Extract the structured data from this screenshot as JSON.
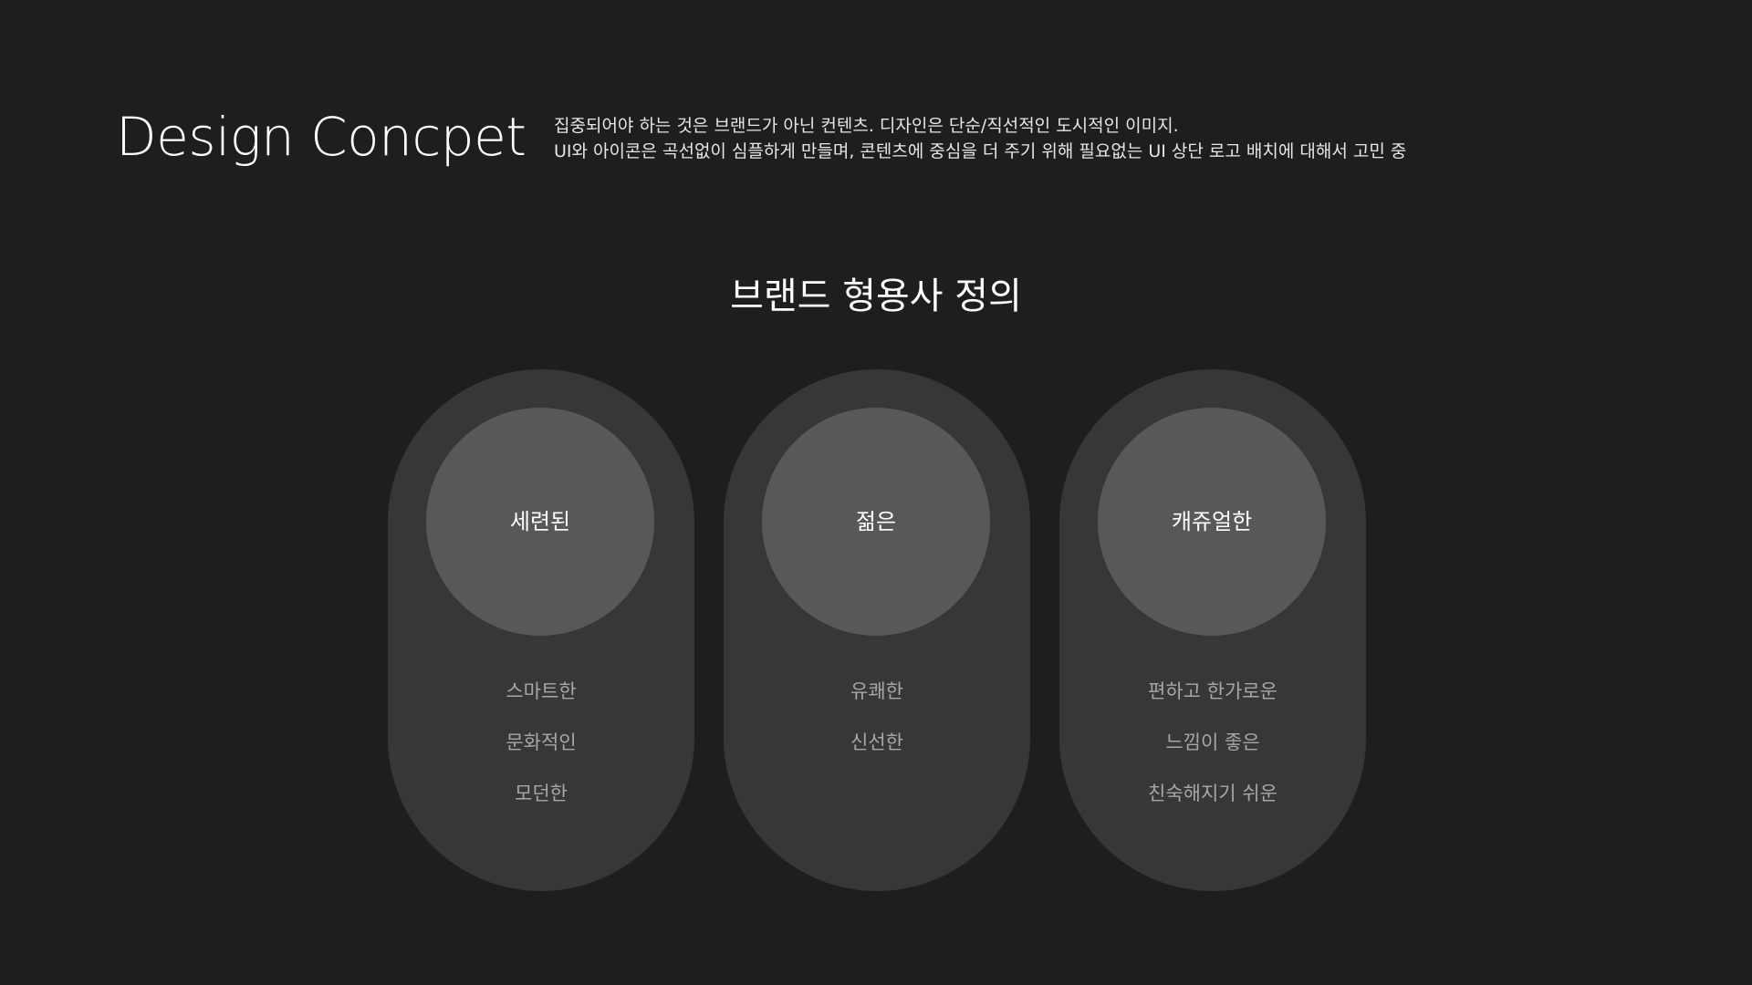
{
  "header": {
    "title": "Design Concpet",
    "description": [
      "집중되어야 하는 것은 브랜드가 아닌 컨텐츠. 디자인은 단순/직선적인 도시적인 이미지.",
      "UI와 아이콘은 곡선없이 심플하게 만들며, 콘텐츠에 중심을 더 주기 위해 필요없는 UI 상단 로고 배치에 대해서 고민 중"
    ]
  },
  "section": {
    "title": "브랜드 형용사 정의"
  },
  "cards": [
    {
      "label": "세련된",
      "attributes": [
        "스마트한",
        "문화적인",
        "모던한"
      ]
    },
    {
      "label": "젊은",
      "attributes": [
        "유쾌한",
        "신선한"
      ]
    },
    {
      "label": "캐쥬얼한",
      "attributes": [
        "편하고 한가로운",
        "느낌이 좋은",
        "친숙해지기 쉬운"
      ]
    }
  ],
  "colors": {
    "background": "#1e1e1e",
    "card": "#373737",
    "circle": "#585858",
    "primary_text": "#ffffff",
    "secondary_text": "#a7a7a7"
  }
}
